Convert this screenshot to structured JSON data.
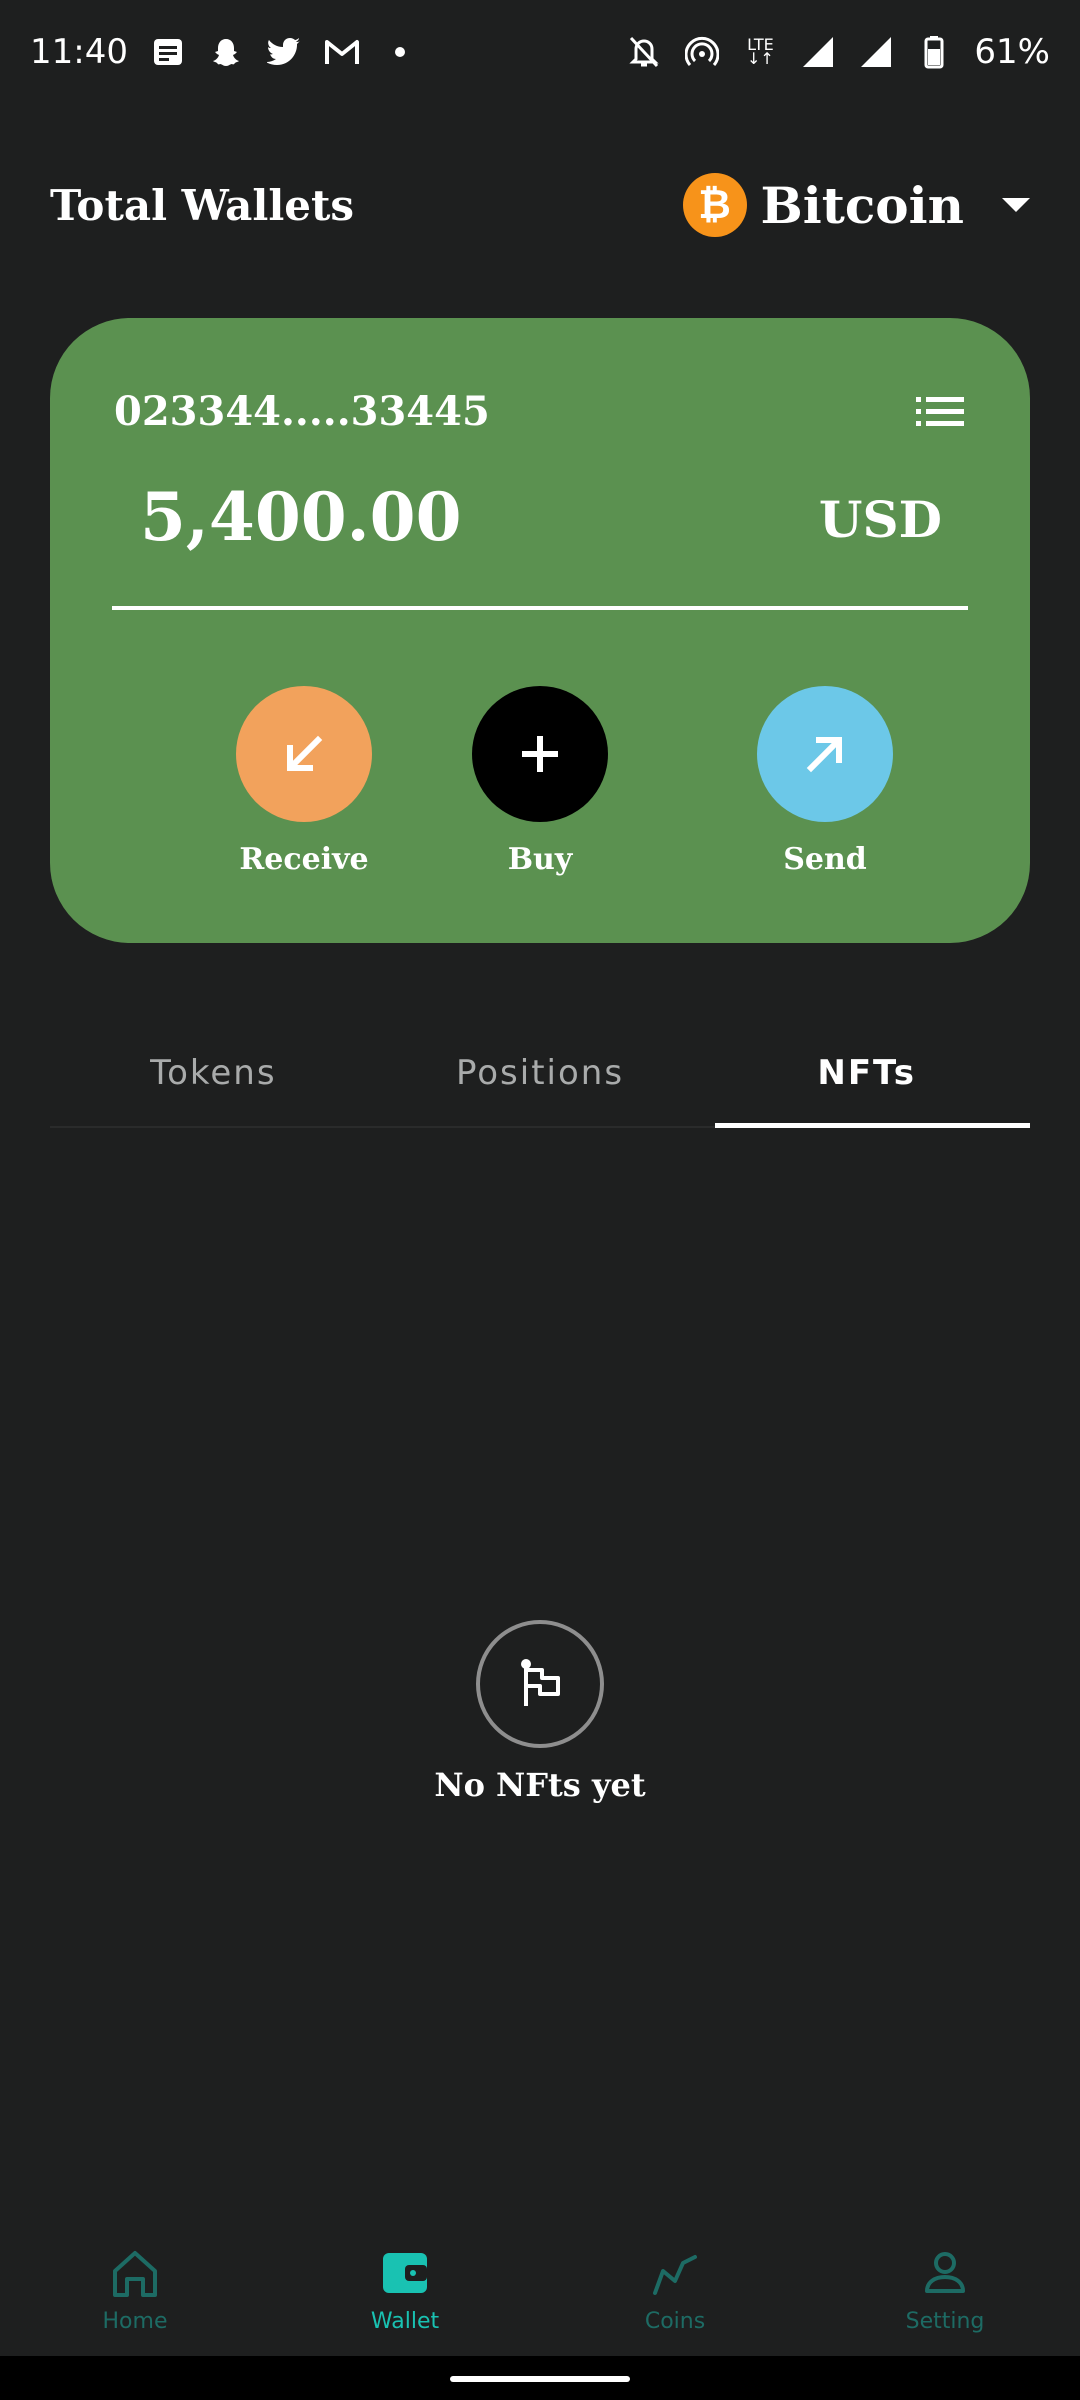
{
  "status_bar": {
    "time": "11:40",
    "battery": "61%",
    "network": "LTE",
    "left_icons": [
      "notes-icon",
      "snapchat-icon",
      "twitter-icon",
      "gmail-icon",
      "dot-icon"
    ],
    "right_icons": [
      "mute-bell-icon",
      "hotspot-icon",
      "lte-icon",
      "signal-icon",
      "signal-icon",
      "battery-icon"
    ]
  },
  "header": {
    "title": "Total Wallets",
    "coin_name": "Bitcoin",
    "coin_symbol": "₿",
    "coin_icon": "bitcoin-icon"
  },
  "card": {
    "address": "023344.....33445",
    "amount": "5,400.00",
    "currency": "USD",
    "background": "#5b9150",
    "actions": [
      {
        "label": "Receive",
        "icon": "arrow-down-left-icon",
        "color": "#f2a25c"
      },
      {
        "label": "Buy",
        "icon": "plus-icon",
        "color": "#000000"
      },
      {
        "label": "Send",
        "icon": "arrow-up-right-icon",
        "color": "#6cc8e8"
      }
    ]
  },
  "tabs": [
    {
      "label": "Tokens",
      "active": false
    },
    {
      "label": "Positions",
      "active": false
    },
    {
      "label": "NFTs",
      "active": true
    }
  ],
  "empty_state": {
    "icon": "flag-icon",
    "text": "No NFts yet"
  },
  "bottom_nav": [
    {
      "label": "Home",
      "icon": "home-icon",
      "active": false
    },
    {
      "label": "Wallet",
      "icon": "wallet-icon",
      "active": true
    },
    {
      "label": "Coins",
      "icon": "chart-line-icon",
      "active": false
    },
    {
      "label": "Setting",
      "icon": "person-icon",
      "active": false
    }
  ],
  "colors": {
    "background": "#1e1f1f",
    "nav_active": "#19c2b2",
    "nav_inactive": "#1d6b64",
    "bitcoin": "#f7931a"
  }
}
